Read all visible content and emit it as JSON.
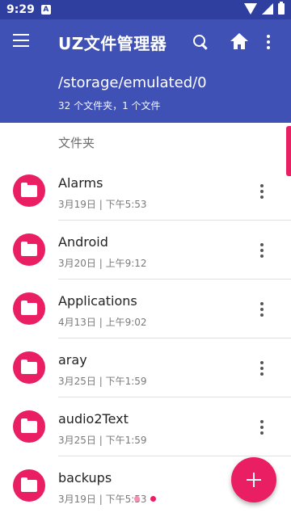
{
  "status_bar": {
    "time": "9:29",
    "notification_icon": "A"
  },
  "app_bar": {
    "title": "UZ文件管理器",
    "icons": [
      "menu-icon",
      "search-icon",
      "home-icon",
      "more-vert-icon"
    ]
  },
  "path_header": {
    "path": "/storage/emulated/0",
    "summary": "32 个文件夹，1 个文件"
  },
  "section": {
    "label": "文件夹"
  },
  "folders": [
    {
      "name": "Alarms",
      "meta": "3月19日 | 下午5:53"
    },
    {
      "name": "Android",
      "meta": "3月20日 | 上午9:12"
    },
    {
      "name": "Applications",
      "meta": "4月13日 | 上午9:02"
    },
    {
      "name": "aray",
      "meta": "3月25日 | 下午1:59"
    },
    {
      "name": "audio2Text",
      "meta": "3月25日 | 下午1:59"
    },
    {
      "name": "backups",
      "meta": "3月19日 | 下午5:53"
    }
  ],
  "fab": {
    "label": "+"
  },
  "colors": {
    "primary": "#3f51b5",
    "status_bar": "#2f3f9f",
    "accent": "#e91e63"
  }
}
